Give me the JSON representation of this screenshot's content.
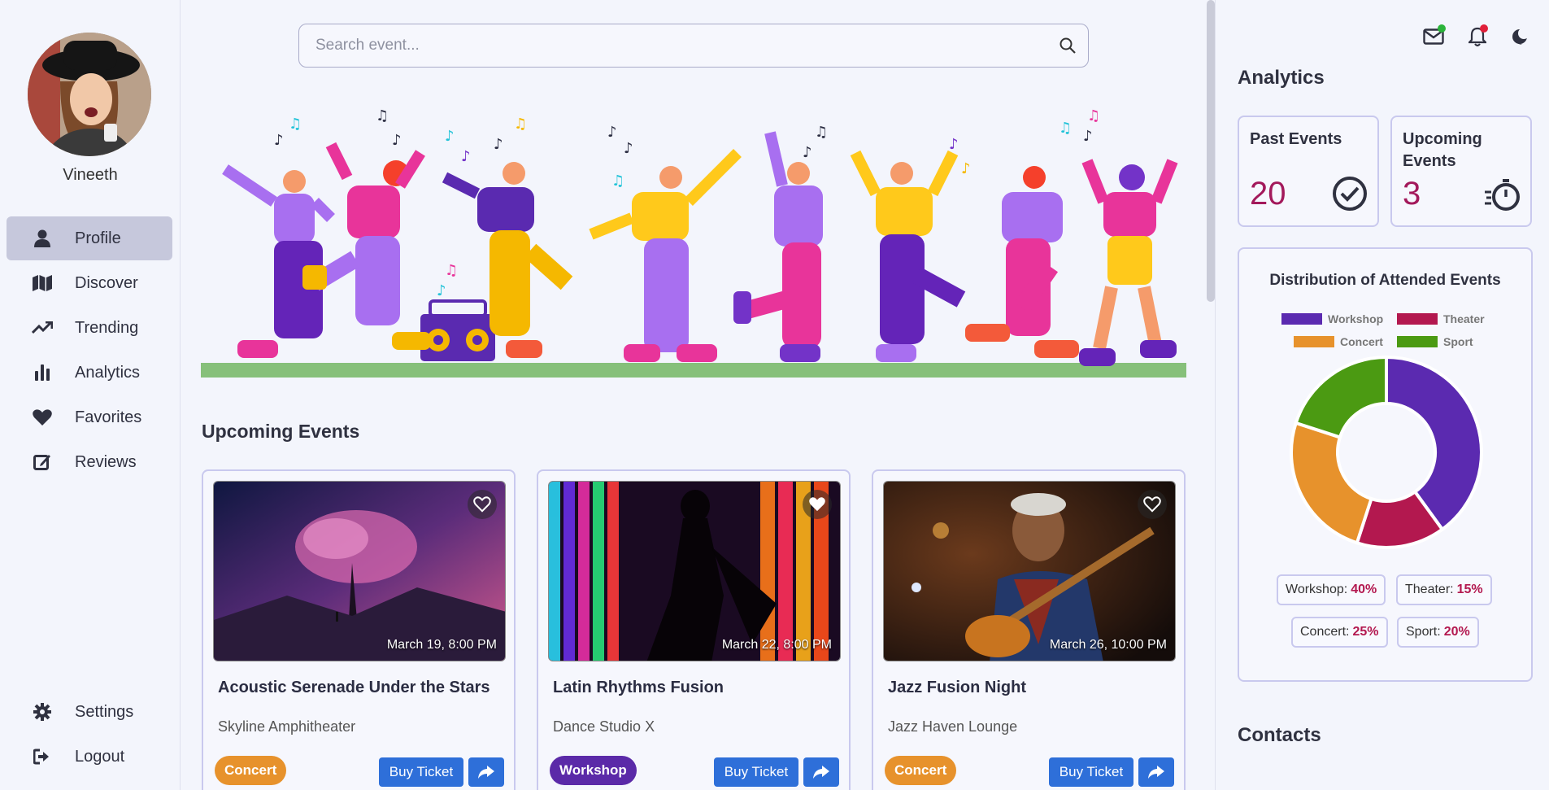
{
  "profile": {
    "name": "Vineeth"
  },
  "nav": {
    "items": [
      {
        "label": "Profile",
        "icon": "user-icon",
        "active": true
      },
      {
        "label": "Discover",
        "icon": "map-icon"
      },
      {
        "label": "Trending",
        "icon": "trending-icon"
      },
      {
        "label": "Analytics",
        "icon": "bar-chart-icon"
      },
      {
        "label": "Favorites",
        "icon": "heart-icon"
      },
      {
        "label": "Reviews",
        "icon": "edit-icon"
      }
    ],
    "bottom": [
      {
        "label": "Settings",
        "icon": "gear-icon"
      },
      {
        "label": "Logout",
        "icon": "logout-icon"
      }
    ]
  },
  "search": {
    "placeholder": "Search event..."
  },
  "upcoming": {
    "title": "Upcoming Events",
    "events": [
      {
        "title": "Acoustic Serenade Under the Stars",
        "venue": "Skyline Amphitheater",
        "date": "March 19, 8:00 PM",
        "category": "Concert",
        "category_color": "#e7922c",
        "buy_label": "Buy Ticket",
        "favorited": false
      },
      {
        "title": "Latin Rhythms Fusion",
        "venue": "Dance Studio X",
        "date": "March 22, 8:00 PM",
        "category": "Workshop",
        "category_color": "#5b2aa8",
        "buy_label": "Buy Ticket",
        "favorited": true
      },
      {
        "title": "Jazz Fusion Night",
        "venue": "Jazz Haven Lounge",
        "date": "March 26, 10:00 PM",
        "category": "Concert",
        "category_color": "#e7922c",
        "buy_label": "Buy Ticket",
        "favorited": false
      }
    ]
  },
  "analytics": {
    "title": "Analytics",
    "past": {
      "label": "Past Events",
      "value": "20"
    },
    "upcoming": {
      "label": "Upcoming Events",
      "value": "3"
    },
    "distribution": {
      "title": "Distribution of Attended Events",
      "legend": [
        {
          "name": "Workshop",
          "color": "#5b2ab0"
        },
        {
          "name": "Theater",
          "color": "#b3184f"
        },
        {
          "name": "Concert",
          "color": "#e7922c"
        },
        {
          "name": "Sport",
          "color": "#4b9a12"
        }
      ],
      "badges": [
        {
          "name": "Workshop:",
          "value": "40%"
        },
        {
          "name": "Theater:",
          "value": "15%"
        },
        {
          "name": "Concert:",
          "value": "25%"
        },
        {
          "name": "Sport:",
          "value": "20%"
        }
      ]
    }
  },
  "chart_data": {
    "type": "pie",
    "title": "Distribution of Attended Events",
    "categories": [
      "Workshop",
      "Theater",
      "Concert",
      "Sport"
    ],
    "values": [
      40,
      15,
      25,
      20
    ],
    "colors": [
      "#5b2ab0",
      "#b3184f",
      "#e7922c",
      "#4b9a12"
    ],
    "legend": "top"
  },
  "contacts": {
    "title": "Contacts"
  }
}
